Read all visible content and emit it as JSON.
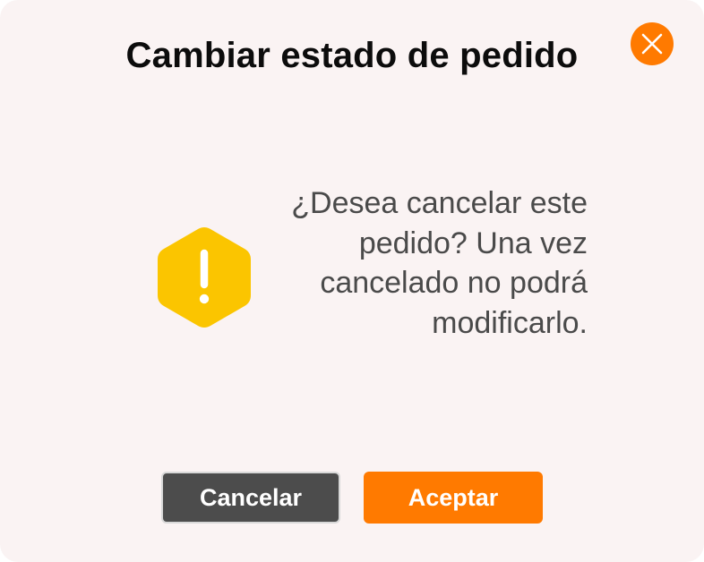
{
  "dialog": {
    "title": "Cambiar estado de pedido",
    "message": "¿Desea cancelar este pedido? Una vez cancelado no podrá modificarlo.",
    "close_icon": "close-icon",
    "warning_icon": "warning-icon",
    "cancel_label": "Cancelar",
    "accept_label": "Aceptar"
  },
  "colors": {
    "accent": "#ff7a00",
    "warning": "#fbc500",
    "cancel_button": "#4c4c4c",
    "background": "#faf3f3"
  }
}
